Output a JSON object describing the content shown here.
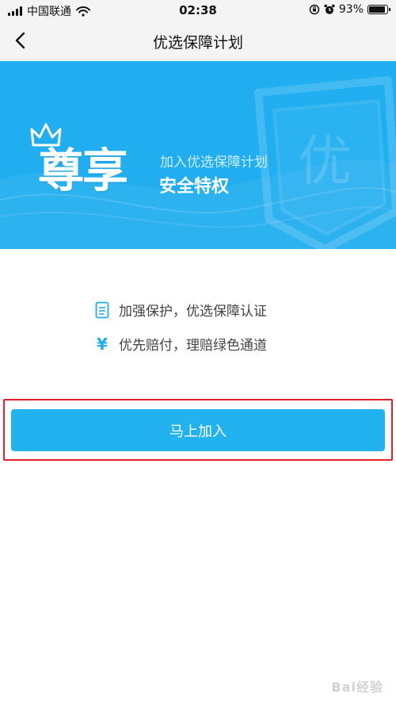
{
  "status_bar": {
    "carrier": "中国联通",
    "time": "02:38",
    "battery_percent": "93%",
    "battery_level": 0.93
  },
  "nav": {
    "title": "优选保障计划"
  },
  "banner": {
    "headline": "尊享",
    "subtitle": "加入优选保障计划",
    "tagline": "安全特权",
    "badge_char": "优",
    "background_color": "#20aef0"
  },
  "features": [
    {
      "icon": "document-icon",
      "text": "加强保护，优选保障认证"
    },
    {
      "icon": "yen-icon",
      "symbol": "¥",
      "text": "优先赔付，理赔绿色通道"
    }
  ],
  "join_button": {
    "label": "马上加入",
    "color": "#22b2f0",
    "highlight_color": "#e6202a"
  },
  "watermark": {
    "text": "Bai经验"
  }
}
